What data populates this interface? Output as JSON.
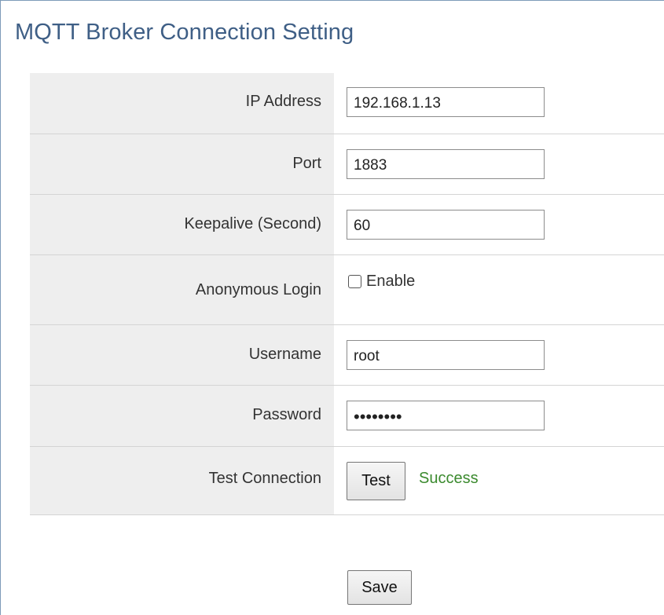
{
  "title": "MQTT Broker Connection Setting",
  "fields": {
    "ip_address": {
      "label": "IP Address",
      "value": "192.168.1.13"
    },
    "port": {
      "label": "Port",
      "value": "1883"
    },
    "keepalive": {
      "label": "Keepalive (Second)",
      "value": "60"
    },
    "anonymous_login": {
      "label": "Anonymous Login",
      "option": "Enable",
      "checked": false
    },
    "username": {
      "label": "Username",
      "value": "root"
    },
    "password": {
      "label": "Password",
      "value": "••••••••"
    },
    "test_connection": {
      "label": "Test Connection",
      "button": "Test",
      "status": "Success",
      "status_color": "#3b8a2e"
    }
  },
  "save_label": "Save",
  "colors": {
    "title": "#3f5f86",
    "label_background": "#eeeeee",
    "border": "#d4d4d4"
  }
}
